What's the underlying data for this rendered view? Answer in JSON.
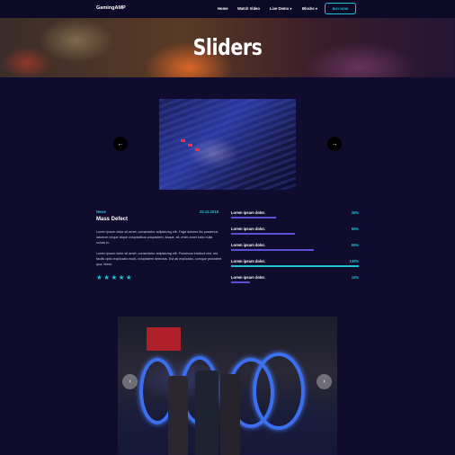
{
  "header": {
    "brand": "GamingAMP",
    "nav": [
      "Home",
      "Watch Video",
      "Live Demo ▾",
      "Blocks ▾"
    ],
    "buy_label": "BUY NOW"
  },
  "hero": {
    "title": "Sliders"
  },
  "slider1": {
    "prev_glyph": "←",
    "next_glyph": "→"
  },
  "article": {
    "tag": "News",
    "date": "20.12.2018",
    "title": "Mass Defect",
    "para1": "Lorem ipsum dolor sit amet, consectetur adipisicing elit. Fuga dolores illo possimus laborum neque atque voluptatibus voluptatem, itaque, sit, enim amet iusto nulla soluta in.",
    "para2": "Lorem ipsum dolor sit amet, consectetur adipisicing elit. Possimus incidunt nisi, est facilis optio explicabo modi, voluptatem delectus. Est ab explicabo, cumque provident qua, libero.",
    "stars": "★★★★★"
  },
  "skills": [
    {
      "label": "Lorem ipsum dolor.",
      "percent": "35%",
      "value": 0.35
    },
    {
      "label": "Lorem ipsum dolor.",
      "percent": "50%",
      "value": 0.5
    },
    {
      "label": "Lorem ipsum dolor.",
      "percent": "65%",
      "value": 0.65
    },
    {
      "label": "Lorem ipsum dolor.",
      "percent": "100%",
      "value": 1.0
    },
    {
      "label": "Lorem ipsum dolor.",
      "percent": "15%",
      "value": 0.15
    }
  ],
  "slider2": {
    "prev_glyph": "‹",
    "next_glyph": "›"
  },
  "colors": {
    "accent": "#1fc3d3",
    "bar": "#5b4fd6",
    "background": "#0f0c2e"
  }
}
